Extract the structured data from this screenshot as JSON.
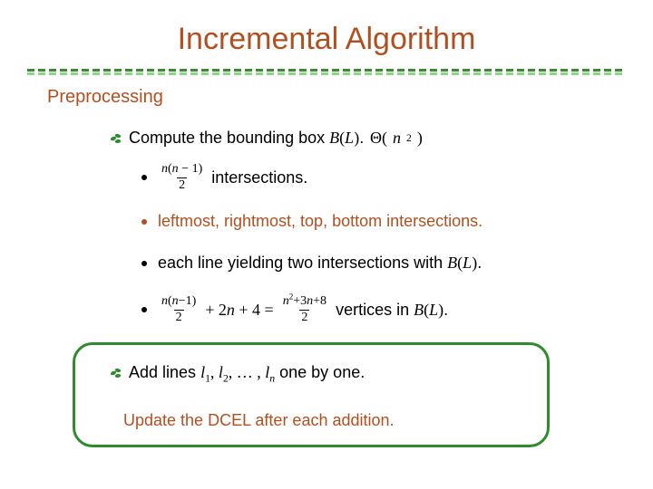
{
  "title": "Incremental Algorithm",
  "section": "Preprocessing",
  "complexity": "Θ(n²)",
  "items": {
    "compute_box": {
      "prefix": "Compute the bounding box ",
      "box_sym": "B(L)",
      "suffix": "."
    },
    "intersections": {
      "frac_num": "n(n−1)",
      "frac_den": "2",
      "suffix": " intersections."
    },
    "extremes": "leftmost, rightmost, top, bottom intersections.",
    "yielding": {
      "prefix": "each line yielding two intersections with ",
      "box_sym": "B(L)",
      "suffix": "."
    },
    "vertices": {
      "frac1_num": "n(n−1)",
      "frac1_den": "2",
      "plus_terms": " + 2n + 4 = ",
      "frac2_num": "n²+3n+8",
      "frac2_den": "2",
      "tail_prefix": " vertices in ",
      "box_sym": "B(L)",
      "suffix": "."
    },
    "add_lines": {
      "prefix": "Add lines ",
      "seq": "l₁, l₂, …, lₙ",
      "suffix": " one by one."
    },
    "update": "Update the DCEL after each addition."
  },
  "deco": {
    "rule_color_a": "#3a8a32",
    "rule_color_b": "#8fd48a"
  }
}
